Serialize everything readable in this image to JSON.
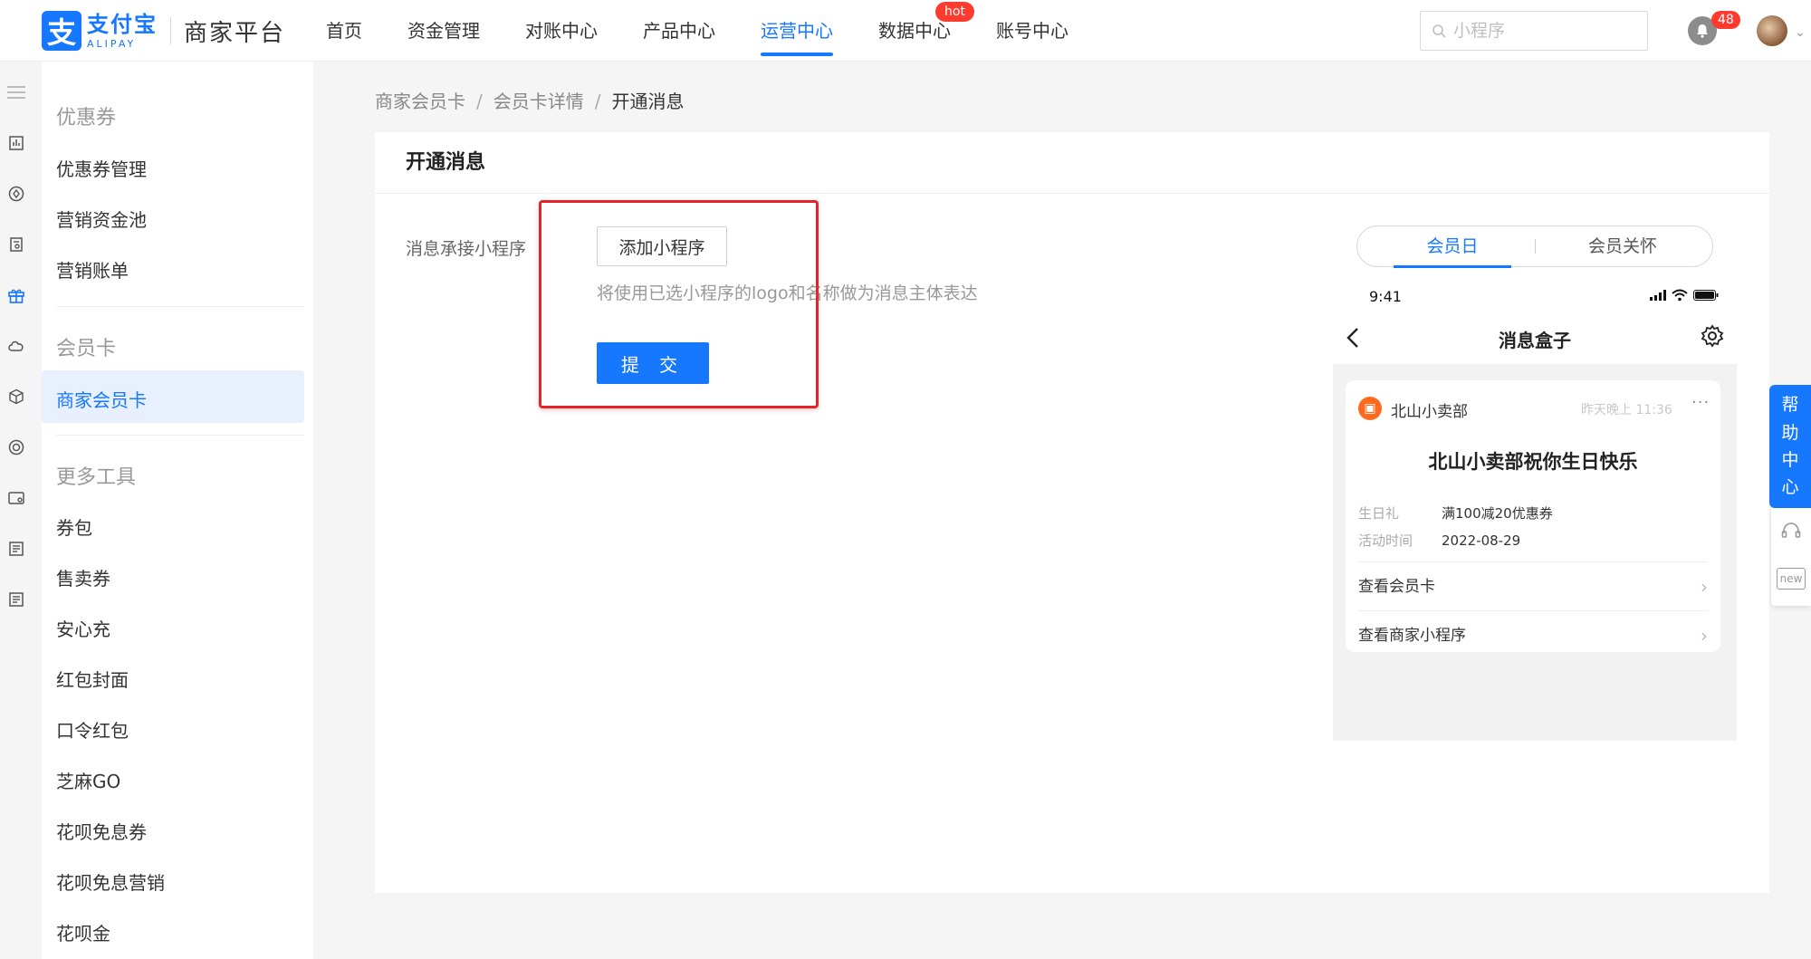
{
  "brand": {
    "logo_cn": "支付宝",
    "logo_en": "ALIPAY",
    "logo_glyph": "支",
    "platform": "商家平台"
  },
  "nav": [
    {
      "label": "首页"
    },
    {
      "label": "资金管理"
    },
    {
      "label": "对账中心"
    },
    {
      "label": "产品中心"
    },
    {
      "label": "运营中心",
      "active": true
    },
    {
      "label": "数据中心",
      "badge": "hot"
    },
    {
      "label": "账号中心"
    }
  ],
  "search": {
    "placeholder": "小程序"
  },
  "notifications": {
    "count": "48"
  },
  "sidebar": {
    "groups": [
      {
        "title": "优惠券",
        "items": [
          "优惠券管理",
          "营销资金池",
          "营销账单"
        ]
      },
      {
        "title": "会员卡",
        "items": [
          "商家会员卡"
        ]
      },
      {
        "title": "更多工具",
        "items": [
          "券包",
          "售卖券",
          "安心充",
          "红包封面",
          "口令红包",
          "芝麻GO",
          "花呗免息券",
          "花呗免息营销",
          "花呗金"
        ]
      }
    ],
    "active_item": "商家会员卡"
  },
  "breadcrumb": [
    "商家会员卡",
    "会员卡详情",
    "开通消息"
  ],
  "card": {
    "title": "开通消息",
    "form_label": "消息承接小程序",
    "add_button": "添加小程序",
    "hint": "将使用已选小程序的logo和名称做为消息主体表达",
    "submit_button": "提 交"
  },
  "preview": {
    "tabs": [
      "会员日",
      "会员关怀"
    ],
    "active_tab": "会员日",
    "status_time": "9:41",
    "page_title": "消息盒子",
    "shop_name": "北山小卖部",
    "shop_time": "昨天晚上 11:36",
    "message_title": "北山小卖部祝你生日快乐",
    "fields": [
      {
        "key": "生日礼",
        "value": "满100减20优惠券"
      },
      {
        "key": "活动时间",
        "value": "2022-08-29"
      }
    ],
    "links": [
      "查看会员卡",
      "查看商家小程序"
    ]
  },
  "help": {
    "label_chars": [
      "帮",
      "助",
      "中",
      "心"
    ],
    "new_label": "new"
  },
  "colors": {
    "accent": "#1677ff",
    "badge": "#ff3b30",
    "highlight": "#e8222a"
  }
}
